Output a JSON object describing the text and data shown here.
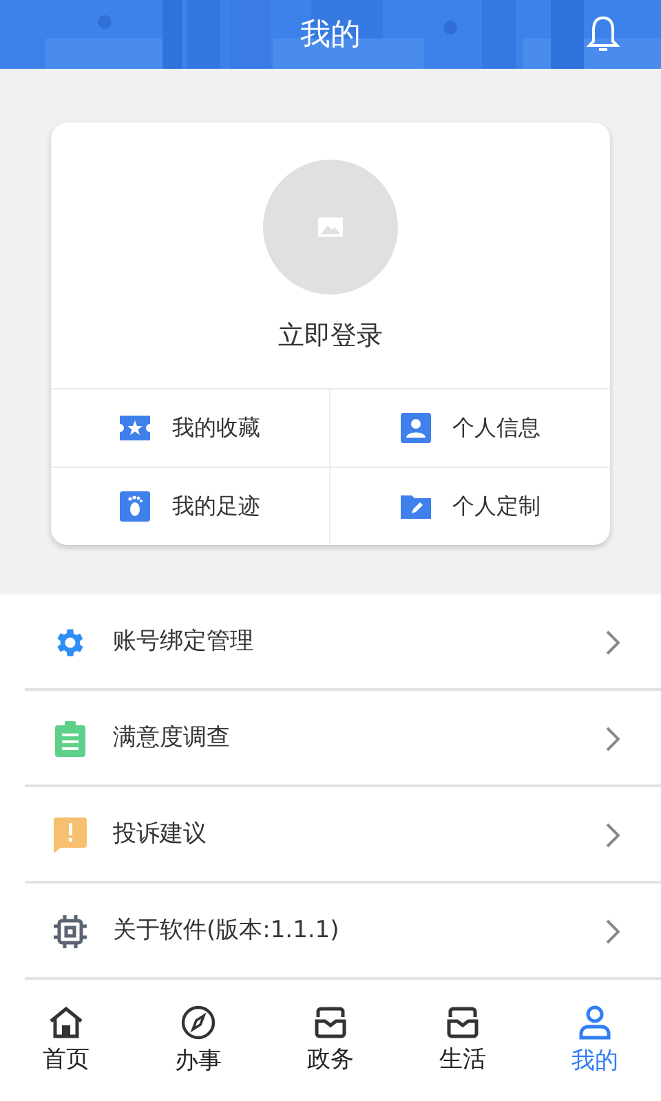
{
  "header": {
    "title": "我的"
  },
  "profile": {
    "login_label": "立即登录",
    "shortcuts": [
      {
        "kind": "ticket",
        "label": "我的收藏"
      },
      {
        "kind": "person",
        "label": "个人信息"
      },
      {
        "kind": "foot",
        "label": "我的足迹"
      },
      {
        "kind": "folder",
        "label": "个人定制"
      }
    ]
  },
  "menu": [
    {
      "kind": "gear",
      "label": "账号绑定管理"
    },
    {
      "kind": "clipboard",
      "label": "满意度调查"
    },
    {
      "kind": "alert",
      "label": "投诉建议"
    },
    {
      "kind": "chip",
      "label": "关于软件(版本:1.1.1)"
    }
  ],
  "tabs": [
    {
      "kind": "home",
      "label": "首页",
      "selected": false
    },
    {
      "kind": "compass",
      "label": "办事",
      "selected": false
    },
    {
      "kind": "tray",
      "label": "政务",
      "selected": false
    },
    {
      "kind": "tray",
      "label": "生活",
      "selected": false
    },
    {
      "kind": "user",
      "label": "我的",
      "selected": true
    }
  ]
}
